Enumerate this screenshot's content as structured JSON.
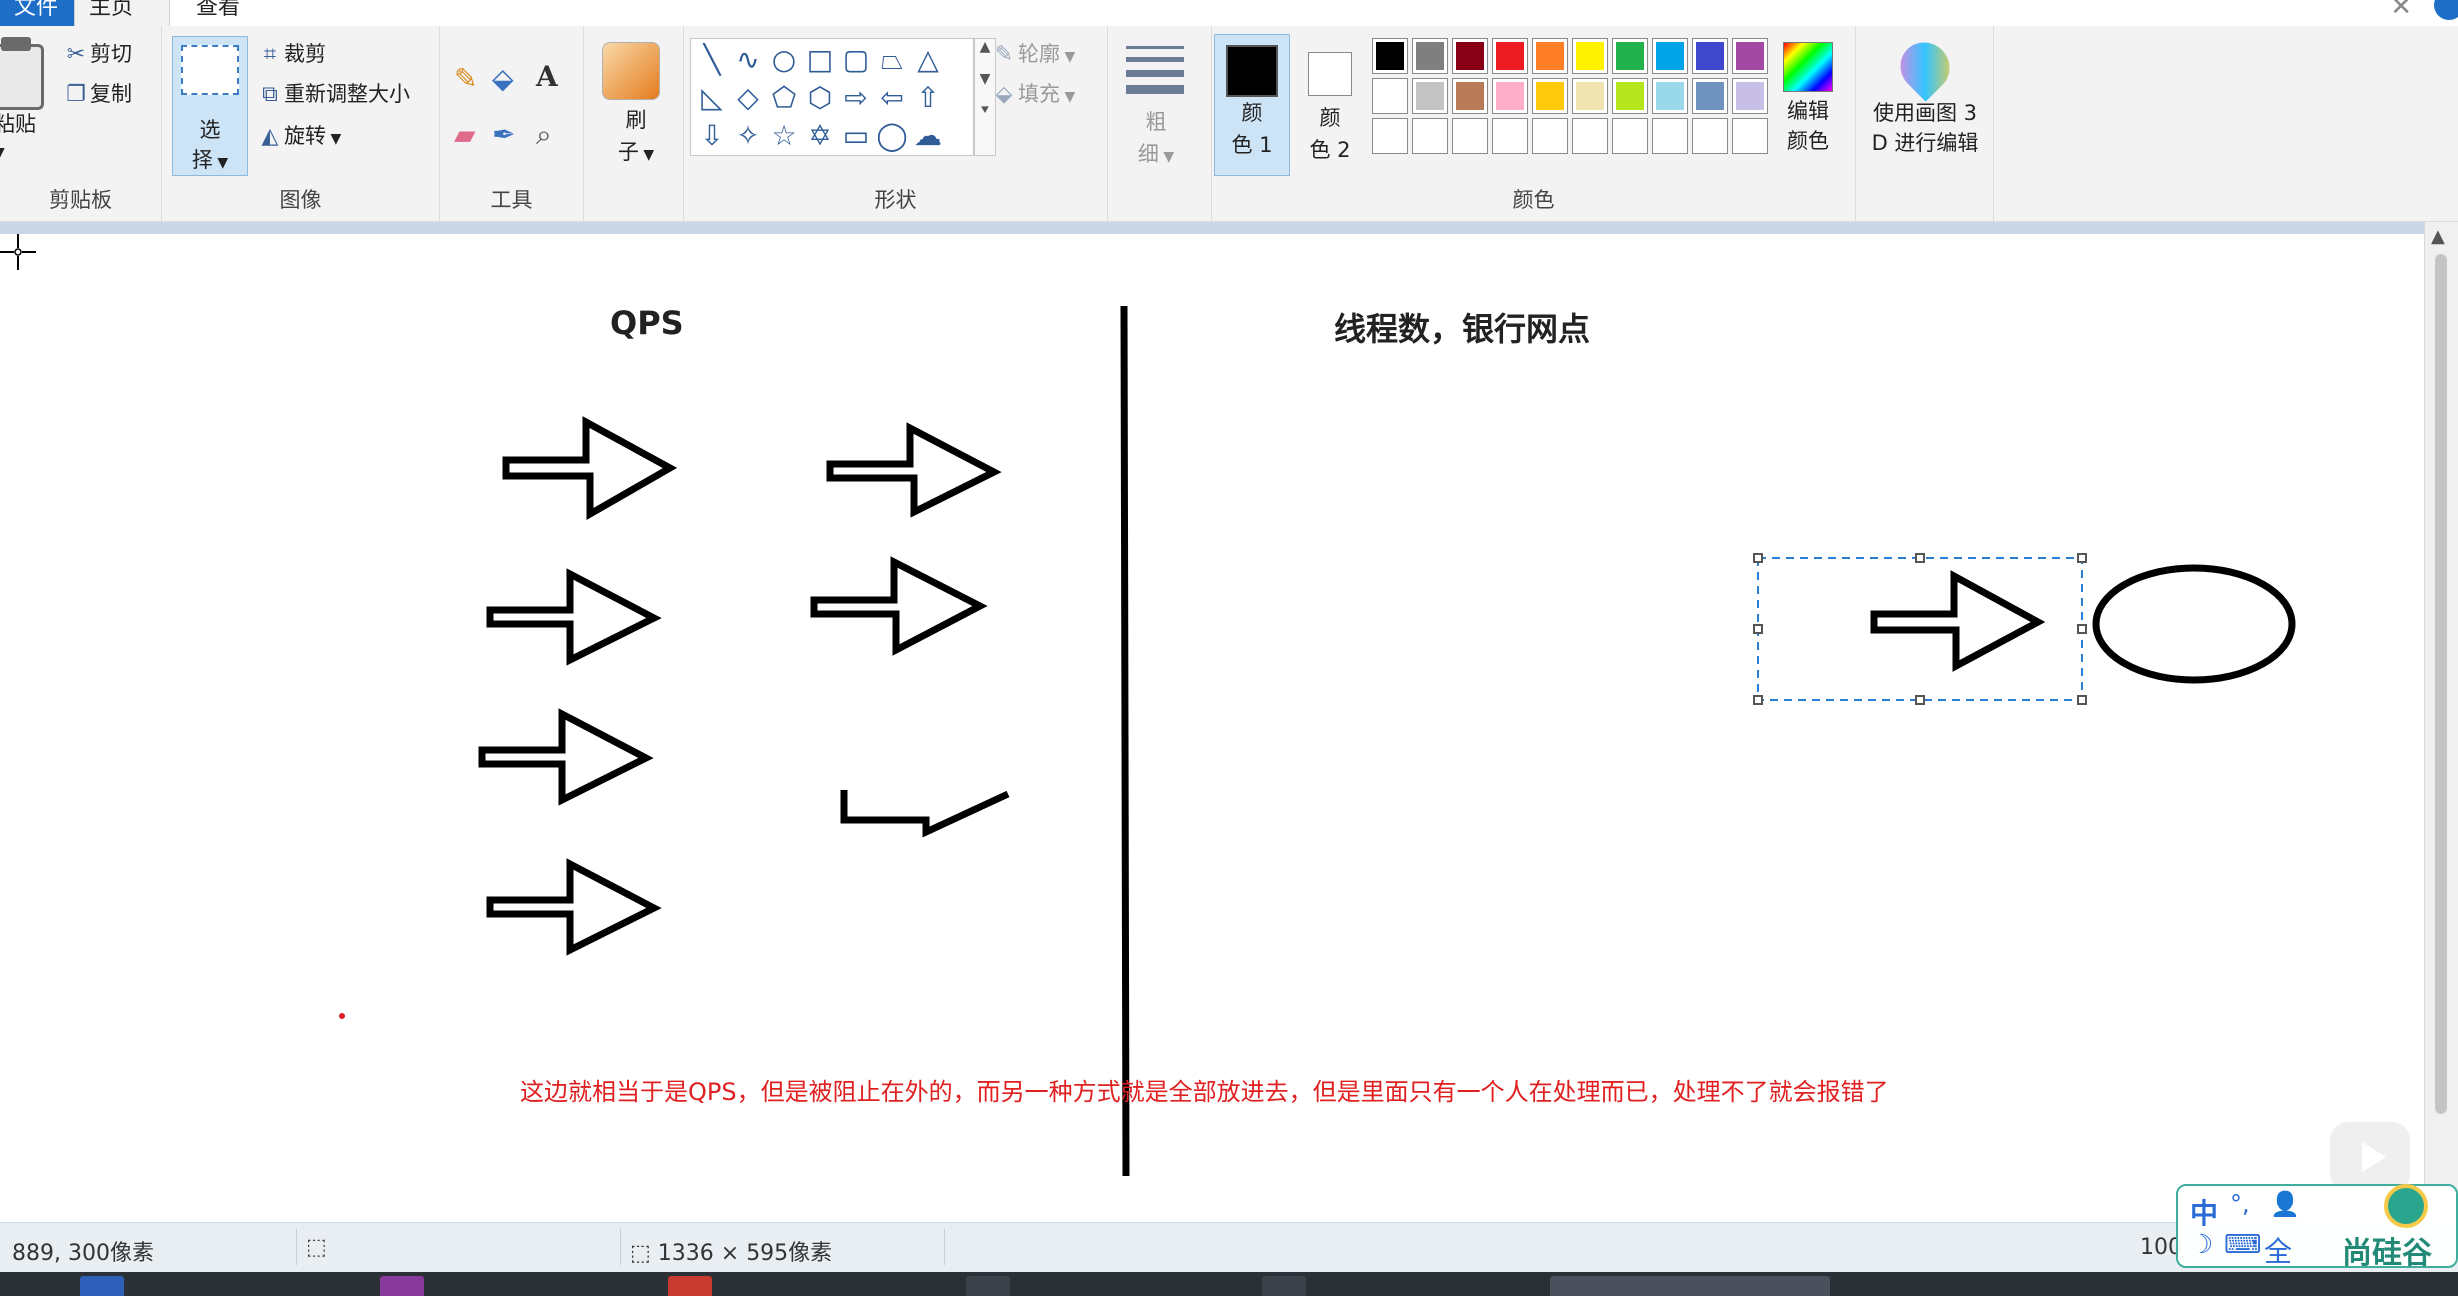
{
  "tabs": {
    "file": "文件",
    "home": "主页",
    "view": "查看"
  },
  "clipboard": {
    "paste": "粘贴",
    "cut": "剪切",
    "copy": "复制",
    "label": "剪贴板"
  },
  "image": {
    "select_line1": "选",
    "select_line2": "择",
    "crop": "裁剪",
    "resize": "重新调整大小",
    "rotate": "旋转",
    "label": "图像"
  },
  "tools": {
    "label": "工具",
    "text_tool": "A"
  },
  "brushes": {
    "line1": "刷",
    "line2": "子"
  },
  "shapes": {
    "outline": "轮廓",
    "fill": "填充",
    "label": "形状"
  },
  "size": {
    "line1": "粗",
    "line2": "细"
  },
  "colors": {
    "color1_line1": "颜",
    "color1_line2": "色 1",
    "color2_line1": "颜",
    "color2_line2": "色 2",
    "edit_line1": "编辑",
    "edit_line2": "颜色",
    "label": "颜色",
    "palette_row1": [
      "#000000",
      "#7f7f7f",
      "#880015",
      "#ed1c24",
      "#ff7f27",
      "#fff200",
      "#22b14c",
      "#00a2e8",
      "#3f48cc",
      "#a349a4"
    ],
    "palette_row2": [
      "#ffffff",
      "#c3c3c3",
      "#b97a57",
      "#ffaec9",
      "#ffc90e",
      "#efe4b0",
      "#b5e61d",
      "#99d9ea",
      "#7092be",
      "#c8bfe7"
    ]
  },
  "paint3d": {
    "line1": "使用画图 3",
    "line2": "D 进行编辑"
  },
  "canvas": {
    "heading_left": "QPS",
    "heading_right": "线程数，银行网点",
    "annotation": "这边就相当于是QPS，但是被阻止在外的，而另一种方式就是全部放进去，但是里面只有一个人在处理而已，处理不了就会报错了",
    "annotation_color": "#e02020"
  },
  "status": {
    "coords": "889, 300像素",
    "dimensions": "1336 × 595像素",
    "zoom": "100"
  },
  "ime": {
    "mode": "中",
    "punct": "°,",
    "full": "全",
    "logo": "尚硅谷"
  }
}
